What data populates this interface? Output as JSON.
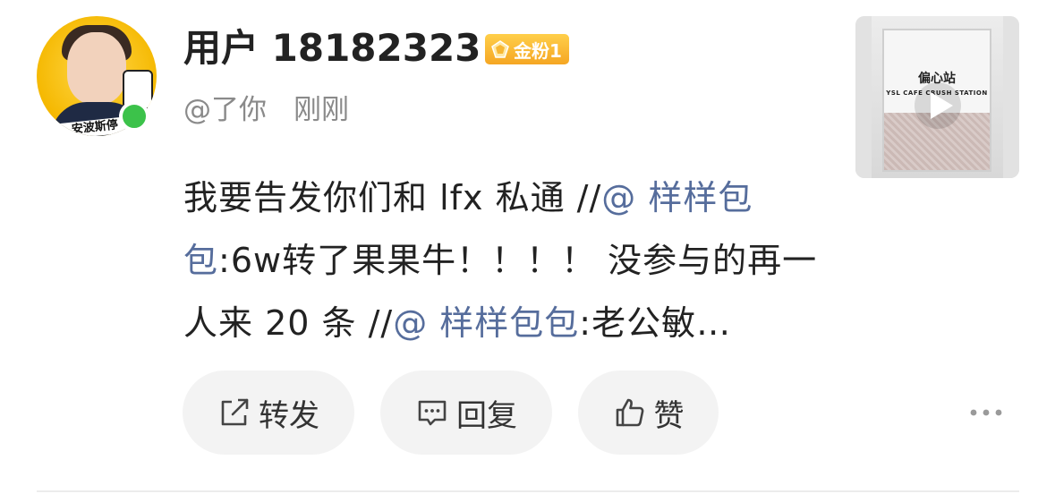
{
  "post": {
    "username": "用户 18182323",
    "fan_badge": "金粉1",
    "handle": "@了你",
    "time": "刚刚",
    "content": {
      "part1": "我要告发你们和 lfx 私通 //",
      "mention1": "@ 样样包包",
      "part2": ":6w转了果果牛！！！！ 没参与的再一人来 20 条 //",
      "mention2": "@ 样样包包",
      "part3": ":老公敏…"
    },
    "thumbnail": {
      "sign_title": "偏心站",
      "sign_subtitle": "YSL CAFE CRUSH STATION"
    },
    "avatar_strip_text": "安波斯停"
  },
  "actions": {
    "repost_label": "转发",
    "reply_label": "回复",
    "like_label": "赞"
  },
  "colors": {
    "mention": "#566d9c",
    "online": "#3cc24a",
    "badge": "#f5a623",
    "button_bg": "#f3f3f3"
  }
}
